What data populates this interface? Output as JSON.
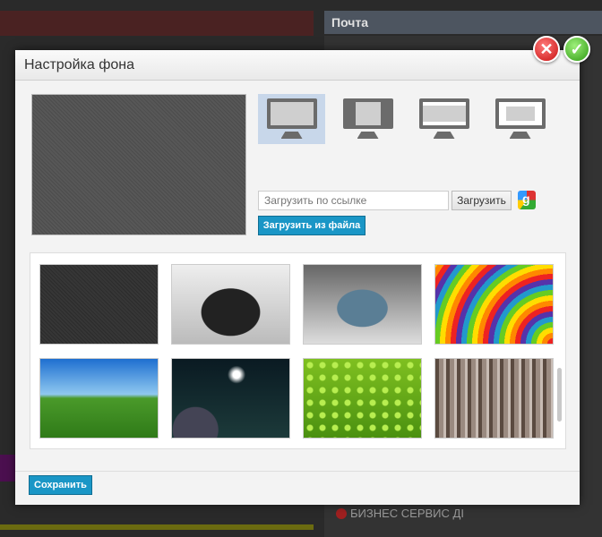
{
  "background": {
    "mail_title": "Почта",
    "bottom_link": "БИЗНЕС СЕРВИС ДІ"
  },
  "dialog": {
    "title": "Настройка фона",
    "modes": [
      "stretch",
      "center",
      "fit-width",
      "tile"
    ],
    "selected_mode": 0,
    "url_input": {
      "placeholder": "Загрузить по ссылке",
      "value": ""
    },
    "load_button": "Загрузить",
    "google_icon_letter": "g",
    "file_button": "Загрузить из файла",
    "thumbnails": [
      "dark-texture",
      "black-muscle-car",
      "blue-convertible",
      "rainbow-waves",
      "green-field-road",
      "space-planets",
      "green-water-drops",
      "wood-stripes"
    ],
    "save_button": "Сохранить"
  },
  "colors": {
    "accent": "#1a96c6"
  }
}
